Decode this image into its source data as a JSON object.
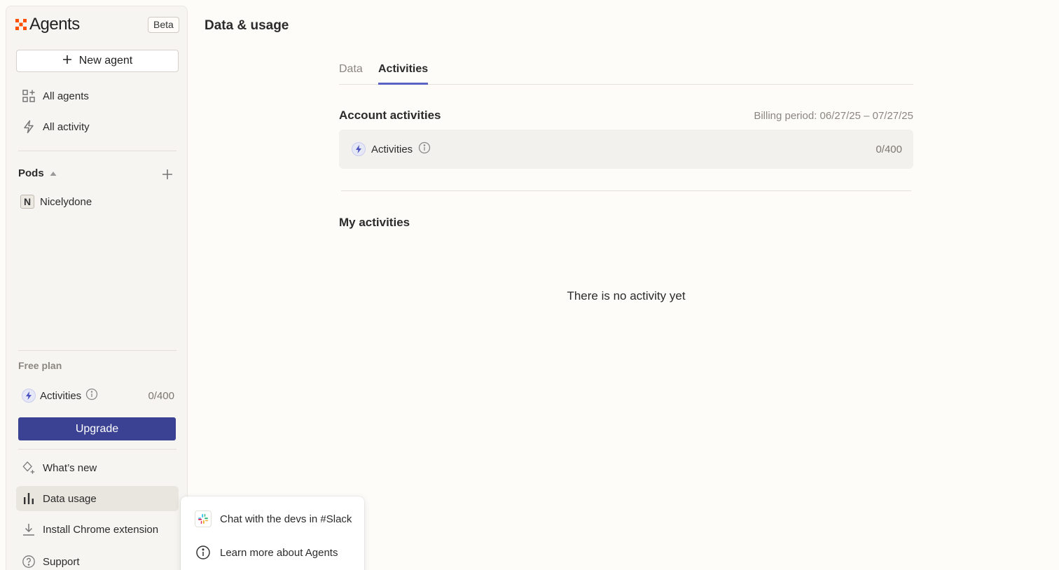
{
  "app": {
    "name": "Agents",
    "badge": "Beta",
    "brand_color": "#ff4f00",
    "accent_color": "#3b4293"
  },
  "sidebar": {
    "new_agent_label": "New agent",
    "nav": [
      {
        "label": "All agents",
        "icon": "grid-icon"
      },
      {
        "label": "All activity",
        "icon": "bolt-icon"
      }
    ],
    "pods": {
      "title": "Pods",
      "items": [
        {
          "initial": "N",
          "label": "Nicelydone"
        }
      ]
    },
    "plan": {
      "title": "Free plan",
      "activities_label": "Activities",
      "activities_count": "0/400",
      "upgrade_label": "Upgrade"
    },
    "footer": [
      {
        "label": "What’s new",
        "icon": "sparkle-icon"
      },
      {
        "label": "Data usage",
        "icon": "bar-chart-icon",
        "active": true
      },
      {
        "label": "Install Chrome extension",
        "icon": "download-icon"
      },
      {
        "label": "Support",
        "icon": "help-icon"
      }
    ]
  },
  "main": {
    "title": "Data & usage",
    "tabs": [
      {
        "label": "Data",
        "active": false
      },
      {
        "label": "Activities",
        "active": true
      }
    ],
    "account": {
      "title": "Account activities",
      "billing_period": "Billing period: 06/27/25 – 07/27/25",
      "activities_label": "Activities",
      "activities_count": "0/400"
    },
    "my_activities": {
      "title": "My activities",
      "empty_text": "There is no activity yet"
    }
  },
  "popup": {
    "items": [
      {
        "label": "Chat with the devs in #Slack",
        "icon": "slack-icon"
      },
      {
        "label": "Learn more about Agents",
        "icon": "info-icon"
      }
    ]
  }
}
